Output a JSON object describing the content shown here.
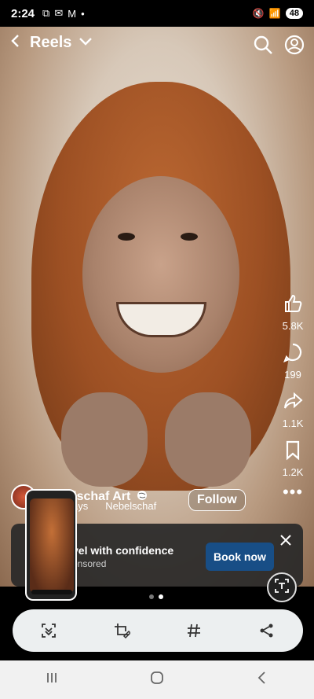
{
  "status_bar": {
    "time": "2:24",
    "battery": "48"
  },
  "header": {
    "title": "Reels"
  },
  "actions": {
    "likes": "5.8K",
    "comments": "199",
    "shares": "1.1K",
    "saves": "1.2K"
  },
  "author": {
    "name": "Nebelschaf Art",
    "follow_label": "Follow",
    "music": "ppy Days",
    "music_author": "Nebelschaf"
  },
  "ad": {
    "headline": "vel with confidence",
    "sponsored": "onsored",
    "cta": "Book now"
  },
  "colors": {
    "cta_bg": "#184e86",
    "toolbar_bg": "#eceff0"
  }
}
